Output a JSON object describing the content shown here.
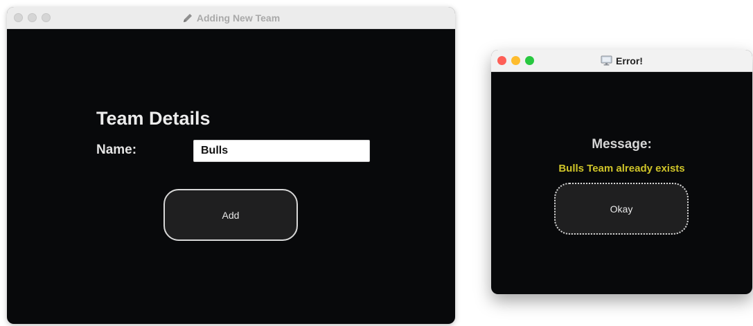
{
  "main_window": {
    "title": "Adding New Team",
    "title_icon": "pencil-icon",
    "heading": "Team Details",
    "name_label": "Name:",
    "name_value": "Bulls",
    "add_label": "Add"
  },
  "error_window": {
    "title": "Error!",
    "title_icon": "monitor-icon",
    "message_label": "Message:",
    "message_text": "Bulls Team already exists",
    "okay_label": "Okay"
  },
  "colors": {
    "window_background": "#08090b",
    "message_text": "#cfc429",
    "close": "#fe5f57",
    "minimize": "#febc2e",
    "zoom": "#28c840"
  }
}
